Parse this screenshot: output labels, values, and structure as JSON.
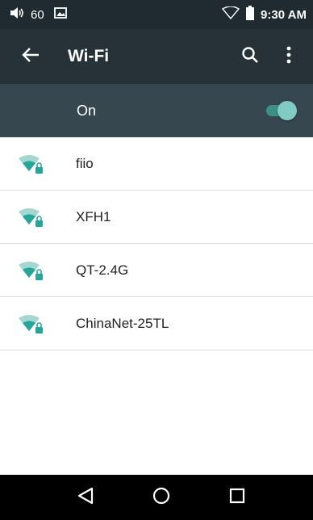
{
  "status_bar": {
    "volume_level": "60",
    "time": "9:30 AM",
    "icons": [
      "volume-icon",
      "image-notification-icon",
      "wifi-signal-icon",
      "battery-icon"
    ]
  },
  "app_bar": {
    "title": "Wi-Fi",
    "icons": [
      "back-arrow-icon",
      "search-icon",
      "more-vert-icon"
    ]
  },
  "wifi_toggle": {
    "label": "On",
    "state": "on"
  },
  "networks": [
    {
      "ssid": "fiio",
      "secured": true
    },
    {
      "ssid": "XFH1",
      "secured": true
    },
    {
      "ssid": "QT-2.4G",
      "secured": true
    },
    {
      "ssid": "ChinaNet-25TL",
      "secured": true
    }
  ],
  "nav_bar": {
    "icons": [
      "back-triangle-icon",
      "home-circle-icon",
      "recents-square-icon"
    ]
  },
  "colors": {
    "status_bar": "#1f2a31",
    "app_bar": "#263238",
    "switch_row": "#37474f",
    "accent": "#26a69a",
    "toggle_thumb": "#80cbc4"
  }
}
